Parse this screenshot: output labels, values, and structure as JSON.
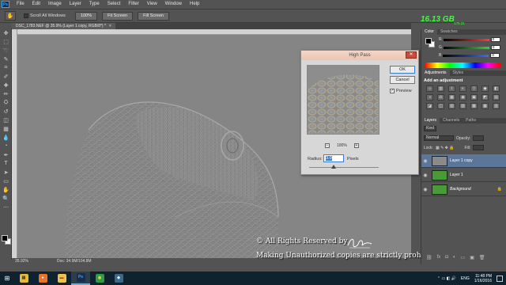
{
  "menu": [
    "File",
    "Edit",
    "Image",
    "Layer",
    "Type",
    "Select",
    "Filter",
    "View",
    "Window",
    "Help"
  ],
  "options": {
    "scroll_all_windows": "Scroll All Windows",
    "zoom_100": "100%",
    "fit_screen": "Fit Screen",
    "fill_screen": "Fill Screen"
  },
  "memory": {
    "value": "16.13 GB",
    "sub": "179.31"
  },
  "document": {
    "tab_title": "DSC_1783.NEF @ 35.9% (Layer 1 copy, RGB/8*) *",
    "close": "×",
    "zoom": "35.92%",
    "doc_size": "Doc: 34.9M/104.8M"
  },
  "watermark": {
    "line1": "© All Rights Reserved by",
    "line2": "Making Unauthorized copies are strictly prohibited"
  },
  "high_pass": {
    "title": "High Pass",
    "ok": "OK",
    "cancel": "Cancel",
    "preview_label": "Preview",
    "preview_checked": true,
    "zoom_pct": "100%",
    "radius_label": "Radius:",
    "radius_value": "3.0",
    "radius_unit": "Pixels",
    "slider_fraction": 0.35
  },
  "panels": {
    "color_tabs": [
      "Color",
      "Swatches"
    ],
    "color_rows": [
      {
        "label": "R",
        "value": "0",
        "color": "#ff3b3b"
      },
      {
        "label": "G",
        "value": "0",
        "color": "#3bcf3b"
      },
      {
        "label": "B",
        "value": "0",
        "color": "#3b6bff"
      }
    ],
    "adj_tabs": [
      "Adjustments",
      "Styles"
    ],
    "adj_heading": "Add an adjustment",
    "adj_icons": [
      "☼",
      "▥",
      "⌇",
      "◐",
      "▽",
      "◆",
      "◧",
      "◑",
      "⚖",
      "▦",
      "◉",
      "▣",
      "◩",
      "▤",
      "◪",
      "◫",
      "▧",
      "▨",
      "▩",
      "▦",
      "▥"
    ],
    "layer_tabs": [
      "Layers",
      "Channels",
      "Paths"
    ],
    "kind_label": "Kind",
    "blend_mode": "Normal",
    "opacity_label": "Opacity:",
    "lock_label": "Lock:",
    "fill_label": "Fill:",
    "layers": [
      {
        "name": "Layer 1 copy",
        "selected": true,
        "thumb": "#8a8a8a"
      },
      {
        "name": "Layer 1",
        "selected": false,
        "thumb": "#4a9a3a"
      },
      {
        "name": "Background",
        "selected": false,
        "thumb": "#4a9a3a"
      }
    ],
    "footer_icons": [
      "⛓",
      "fx",
      "◘",
      "◐",
      "▭",
      "▣",
      "🗑"
    ]
  },
  "taskbar": {
    "lang": "ENG",
    "time": "11:48 PM",
    "date": "1/16/2016",
    "apps": [
      {
        "name": "file-explorer-icon",
        "glyph": "▤",
        "bg": "#e8b838",
        "fg": "#333"
      },
      {
        "name": "firefox-icon",
        "glyph": "●",
        "bg": "#e8742c",
        "fg": "#fff"
      },
      {
        "name": "folder-icon",
        "glyph": "▬",
        "bg": "#f0c050",
        "fg": "#805010"
      },
      {
        "name": "photoshop-icon",
        "glyph": "Ps",
        "bg": "#1b2b4a",
        "fg": "#31a8ff",
        "active": true
      },
      {
        "name": "chrome-icon",
        "glyph": "◉",
        "bg": "#2f9a4a",
        "fg": "#f2d33a"
      },
      {
        "name": "app-icon",
        "glyph": "◈",
        "bg": "#3a6a8a",
        "fg": "#fff"
      }
    ]
  }
}
